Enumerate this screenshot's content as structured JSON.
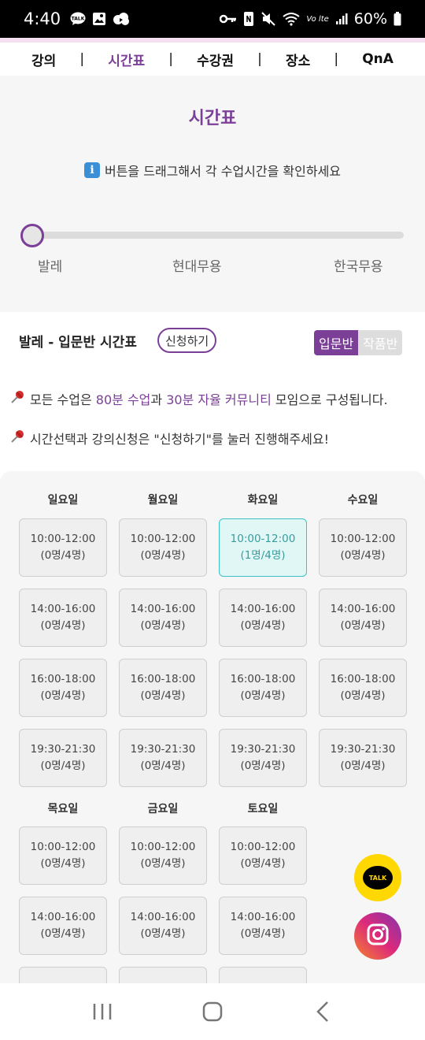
{
  "status_bar": {
    "time": "4:40",
    "battery": "60%",
    "left_icons": [
      "talk-icon",
      "gallery-icon",
      "cloud-icon"
    ],
    "right_icons": [
      "key-icon",
      "nfc-icon",
      "mute-icon",
      "wifi-icon",
      "volte-icon",
      "signal-icon",
      "battery-icon"
    ],
    "volte": "Vo lte"
  },
  "nav": {
    "items": [
      "강의",
      "시간표",
      "수강권",
      "장소",
      "QnA"
    ],
    "separator": "|",
    "active_index": 1,
    "active_color": "#7b3f98"
  },
  "header": {
    "title": "시간표",
    "info_icon": "i",
    "info_text": "버튼을 드래그해서 각 수업시간을 확인하세요",
    "slider": {
      "labels": [
        "발레",
        "현대무용",
        "한국무용"
      ],
      "selected_index": 0
    }
  },
  "class_panel": {
    "title": "발레 - 입문반 시간표",
    "apply_label": "신청하기",
    "levels": [
      "입문반",
      "작품반"
    ],
    "active_level_index": 0
  },
  "notices": {
    "n1_pre": "모든 수업은",
    "n1_accent1": "80분 수업",
    "n1_mid": "과",
    "n1_accent2": "30분 자율 커뮤니티",
    "n1_post": "모임으로 구성됩니다.",
    "n2": "시간선택과 강의신청은 \"신청하기\"를 눌러 진행해주세요!"
  },
  "schedule": {
    "days_row1": [
      "일요일",
      "월요일",
      "화요일",
      "수요일"
    ],
    "days_row2": [
      "목요일",
      "금요일",
      "토요일"
    ],
    "row1_slots": [
      [
        "10:00-12:00",
        "(0명/4명)"
      ],
      [
        "10:00-12:00",
        "(0명/4명)"
      ],
      [
        "10:00-12:00",
        "(1명/4명)"
      ],
      [
        "10:00-12:00",
        "(0명/4명)"
      ],
      [
        "14:00-16:00",
        "(0명/4명)"
      ],
      [
        "14:00-16:00",
        "(0명/4명)"
      ],
      [
        "14:00-16:00",
        "(0명/4명)"
      ],
      [
        "14:00-16:00",
        "(0명/4명)"
      ],
      [
        "16:00-18:00",
        "(0명/4명)"
      ],
      [
        "16:00-18:00",
        "(0명/4명)"
      ],
      [
        "16:00-18:00",
        "(0명/4명)"
      ],
      [
        "16:00-18:00",
        "(0명/4명)"
      ],
      [
        "19:30-21:30",
        "(0명/4명)"
      ],
      [
        "19:30-21:30",
        "(0명/4명)"
      ],
      [
        "19:30-21:30",
        "(0명/4명)"
      ],
      [
        "19:30-21:30",
        "(0명/4명)"
      ]
    ],
    "row2_slots": [
      [
        "10:00-12:00",
        "(0명/4명)"
      ],
      [
        "10:00-12:00",
        "(0명/4명)"
      ],
      [
        "10:00-12:00",
        "(0명/4명)"
      ],
      [
        "14:00-16:00",
        "(0명/4명)"
      ],
      [
        "14:00-16:00",
        "(0명/4명)"
      ],
      [
        "14:00-16:00",
        "(0명/4명)"
      ],
      [
        "",
        ""
      ],
      [
        "",
        ""
      ],
      [
        "",
        ""
      ]
    ],
    "selected_slot": "row1-2"
  },
  "floating": {
    "kakao_label": "TALK",
    "insta_icon": "instagram-icon"
  },
  "bottom_nav": {
    "icons": [
      "recent-apps-icon",
      "home-icon",
      "back-icon"
    ]
  }
}
